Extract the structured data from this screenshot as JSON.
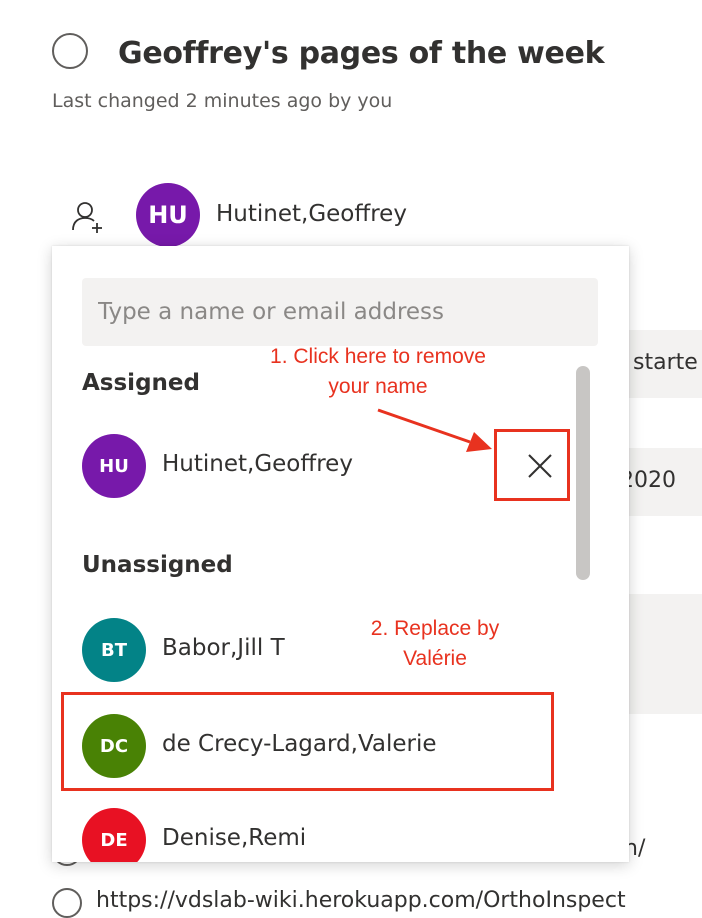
{
  "header": {
    "title": "Geoffrey's pages of the week",
    "last_changed": "Last changed 2 minutes ago by you",
    "assignee": {
      "initials": "HU",
      "name": "Hutinet,Geoffrey",
      "color": "#7719aa"
    }
  },
  "background": {
    "fragment_started": "starte",
    "fragment_date": "2020",
    "fragment_slash": "n/",
    "fragment_url": "https://vdslab-wiki.herokuapp.com/OrthoInspect"
  },
  "picker": {
    "search_placeholder": "Type a name or email address",
    "assigned_label": "Assigned",
    "unassigned_label": "Unassigned",
    "assigned": [
      {
        "initials": "HU",
        "name": "Hutinet,Geoffrey",
        "color": "#7719aa"
      }
    ],
    "unassigned": [
      {
        "initials": "BT",
        "name": "Babor,Jill T",
        "color": "#038387"
      },
      {
        "initials": "DC",
        "name": "de Crecy-Lagard,Valerie",
        "color": "#498205"
      },
      {
        "initials": "DE",
        "name": "Denise,Remi",
        "color": "#e81123"
      }
    ]
  },
  "annotations": {
    "step1_line1": "1. Click here to remove",
    "step1_line2": "your name",
    "step2_line1": "2. Replace by",
    "step2_line2": "Valérie",
    "color": "#e8321f"
  }
}
